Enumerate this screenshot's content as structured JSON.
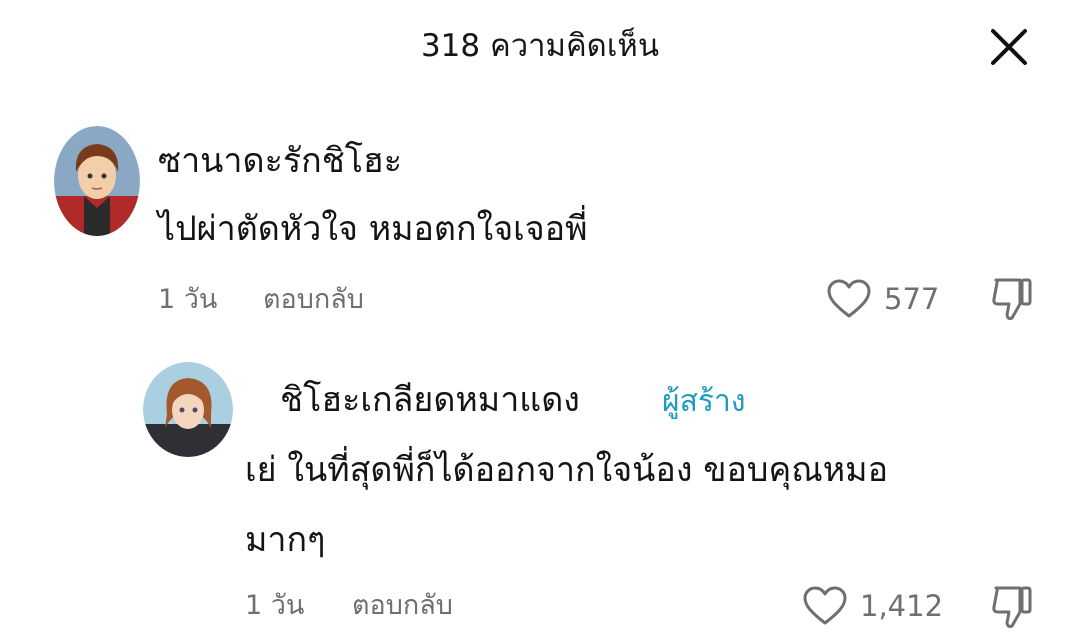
{
  "header": {
    "title": "318 ความคิดเห็น"
  },
  "comments": [
    {
      "author": "ซานาดะรักชิโฮะ",
      "text": "ไปผ่าตัดหัวใจ หมอตกใจเจอพี่",
      "time": "1 วัน",
      "reply_label": "ตอบกลับ",
      "likes": "577"
    },
    {
      "author": "ชิโฮะเกลียดหมาแดง",
      "badge": "ผู้สร้าง",
      "text_line1": "เย่ ในที่สุดพี่ก็ได้ออกจากใจน้อง ขอบคุณหมอ",
      "text_line2": "มากๆ",
      "time": "1 วัน",
      "reply_label": "ตอบกลับ",
      "likes": "1,412"
    }
  ],
  "icons": {
    "close": "close-icon",
    "like": "heart-outline-icon",
    "dislike": "thumbs-down-icon"
  },
  "colors": {
    "creator_badge": "#1d9bc0",
    "meta_text": "#6f6f6f"
  }
}
